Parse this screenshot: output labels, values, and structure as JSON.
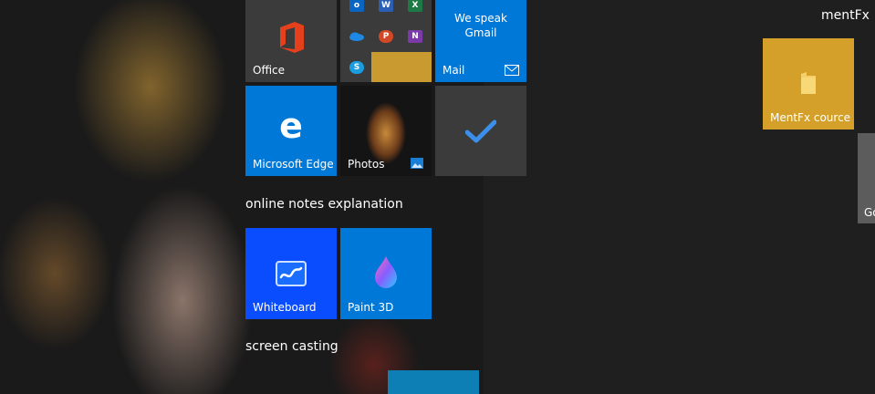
{
  "groups": {
    "productivity_title": "",
    "notes_title": "online  notes explanation",
    "casting_title": "screen casting",
    "mentfx_title": "mentFx"
  },
  "tiles": {
    "office": {
      "label": "Office",
      "color": "#3b3b3b"
    },
    "office_apps": {
      "color": "#3b3b3b",
      "apps": [
        "Outlook",
        "Word",
        "Excel",
        "OneDrive",
        "PowerPoint",
        "OneNote",
        "Skype"
      ]
    },
    "mail": {
      "label": "Mail",
      "promo_line1": "We speak",
      "promo_line2": "Gmail",
      "color": "#0078d7"
    },
    "edge": {
      "label": "Microsoft Edge",
      "color": "#0078d7"
    },
    "photos": {
      "label": "Photos"
    },
    "todo": {
      "label": "",
      "color": "#3b3b3b"
    },
    "whiteboard": {
      "label": "Whiteboard",
      "color": "#0a4dff"
    },
    "paint3d": {
      "label": "Paint 3D",
      "color": "#0078d7"
    },
    "cast": {
      "label": "",
      "color": "#0e7fb5"
    },
    "mentfx_folder": {
      "label": "MentFx cource",
      "color": "#d4a02a"
    },
    "partial_right": {
      "label": "Go",
      "color": "#5c5c5c"
    }
  }
}
